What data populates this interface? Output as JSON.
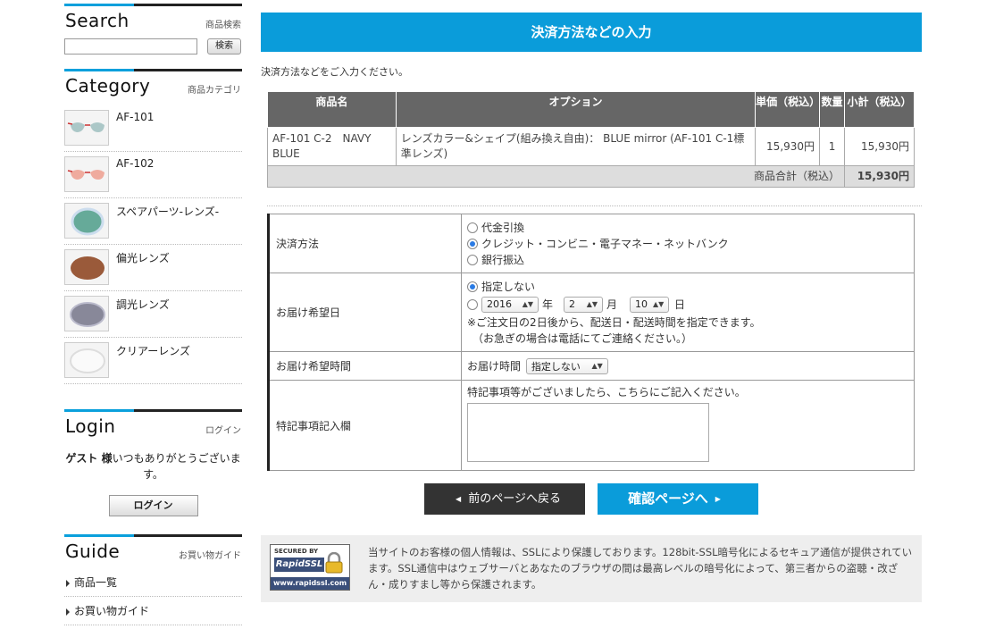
{
  "sidebar": {
    "search": {
      "title": "Search",
      "subtitle": "商品検索",
      "button": "検索",
      "value": ""
    },
    "category": {
      "title": "Category",
      "subtitle": "商品カテゴリ",
      "items": [
        {
          "label": "AF-101",
          "thumb": "sunglasses-thumb"
        },
        {
          "label": "AF-102",
          "thumb": "sunglasses-thumb"
        },
        {
          "label": "スペアパーツ-レンズ-",
          "thumb": "lens-green-thumb"
        },
        {
          "label": "偏光レンズ",
          "thumb": "lens-brown-thumb"
        },
        {
          "label": "調光レンズ",
          "thumb": "lens-gray-thumb"
        },
        {
          "label": "クリアーレンズ",
          "thumb": "lens-clear-thumb"
        }
      ]
    },
    "login": {
      "title": "Login",
      "subtitle": "ログイン",
      "guest_bold": "ゲスト 様",
      "message": "いつもありがとうございます。",
      "button": "ログイン"
    },
    "guide": {
      "title": "Guide",
      "subtitle": "お買い物ガイド",
      "items": [
        {
          "label": "商品一覧"
        },
        {
          "label": "お買い物ガイド"
        }
      ]
    }
  },
  "main": {
    "title": "決済方法などの入力",
    "intro": "決済方法などをご入力ください。",
    "cart": {
      "headers": {
        "name": "商品名",
        "option": "オプション",
        "price": "単価（税込）",
        "qty": "数量",
        "subtotal": "小計（税込）"
      },
      "rows": [
        {
          "name": "AF-101 C-2　NAVY BLUE",
          "option": "レンズカラー&シェイプ(組み換え自由)： BLUE mirror (AF-101 C-1標準レンズ)",
          "price": "15,930円",
          "qty": "1",
          "subtotal": "15,930円"
        }
      ],
      "total_label": "商品合計（税込）",
      "total_value": "15,930円"
    },
    "form": {
      "payment": {
        "label": "決済方法",
        "options": [
          {
            "label": "代金引換",
            "selected": false
          },
          {
            "label": "クレジット・コンビニ・電子マネー・ネットバンク",
            "selected": true
          },
          {
            "label": "銀行振込",
            "selected": false
          }
        ]
      },
      "delivery_date": {
        "label": "お届け希望日",
        "opt_none": "指定しない",
        "year": "2016",
        "year_unit": "年",
        "month": "2",
        "month_unit": "月",
        "day": "10",
        "day_unit": "日",
        "note1": "※ご注文日の2日後から、配送日・配送時間を指定できます。",
        "note2": "（お急ぎの場合は電話にてご連絡ください。）"
      },
      "delivery_time": {
        "label": "お届け希望時間",
        "prefix": "お届け時間",
        "value": "指定しない"
      },
      "remarks": {
        "label": "特記事項記入欄",
        "note": "特記事項等がございましたら、こちらにご記入ください。",
        "value": ""
      }
    },
    "buttons": {
      "back": "前のページへ戻る",
      "next": "確認ページへ"
    },
    "ssl": {
      "badge_top": "SECURED BY",
      "badge_brand": "RapidSSL",
      "badge_url": "www.rapidssl.com",
      "text": "当サイトのお客様の個人情報は、SSLにより保護しております。128bit-SSL暗号化によるセキュア通信が提供されています。SSL通信中はウェブサーバとあなたのブラウザの間は最高レベルの暗号化によって、第三者からの盗聴・改ざん・成りすまし等から保護されます。"
    }
  },
  "colors": {
    "accent": "#0a9cda",
    "header_gray": "#666666",
    "dark": "#333333"
  }
}
